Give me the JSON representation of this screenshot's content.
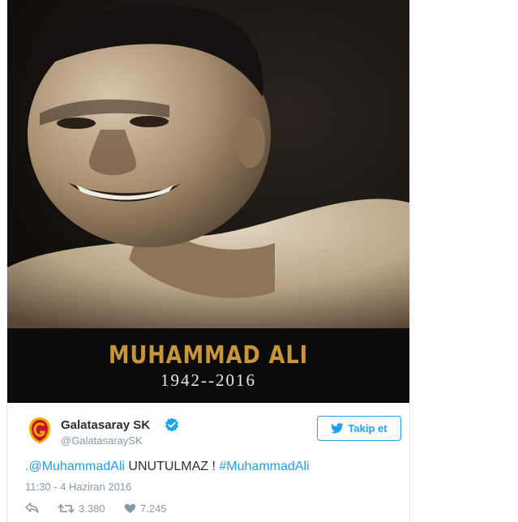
{
  "media": {
    "banner_name": "MUHAMMAD ALI",
    "banner_years": "1942--2016"
  },
  "author": {
    "display_name": "Galatasaray SK",
    "handle": "@GalatasaraySK",
    "verified_icon": "verified-badge-icon",
    "avatar_icon": "galatasaray-logo"
  },
  "follow_button": {
    "icon": "twitter-bird-icon",
    "label": "Takip et"
  },
  "tweet": {
    "mention": ".@MuhammadAli",
    "text": " UNUTULMAZ ! ",
    "hashtag": "#MuhammadAli",
    "timestamp": "11:30 - 4 Haziran 2016"
  },
  "actions": {
    "reply_icon": "reply-icon",
    "retweet_icon": "retweet-icon",
    "retweet_count": "3.380",
    "like_icon": "heart-icon",
    "like_count": "7.245"
  },
  "colors": {
    "link": "#1da1f2",
    "banner_gold": "#c8953b",
    "text": "#292f33",
    "muted": "#8899a6"
  }
}
